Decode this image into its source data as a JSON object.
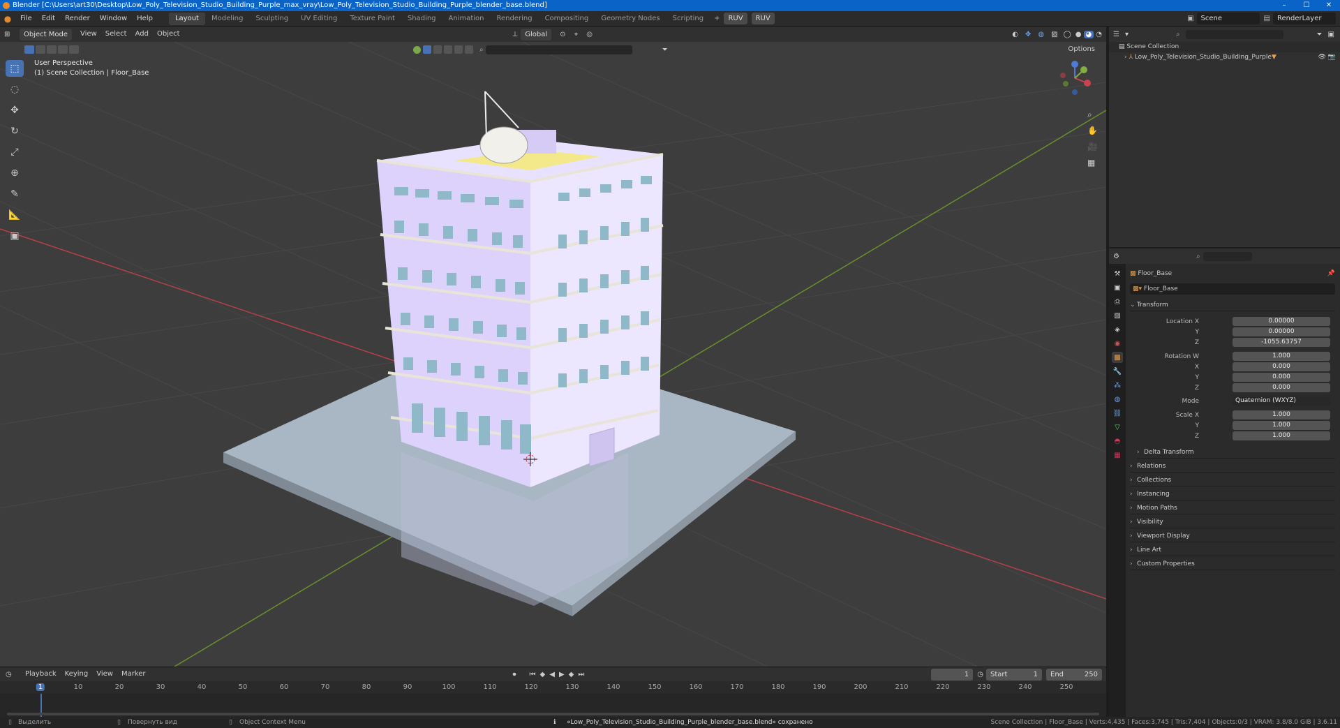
{
  "titlebar": {
    "title": "Blender [C:\\Users\\art30\\Desktop\\Low_Poly_Television_Studio_Building_Purple_max_vray\\Low_Poly_Television_Studio_Building_Purple_blender_base.blend]",
    "minimize": "–",
    "maximize": "☐",
    "close": "✕"
  },
  "menus": [
    "File",
    "Edit",
    "Render",
    "Window",
    "Help"
  ],
  "workspaces": [
    "Layout",
    "Modeling",
    "Sculpting",
    "UV Editing",
    "Texture Paint",
    "Shading",
    "Animation",
    "Rendering",
    "Compositing",
    "Geometry Nodes",
    "Scripting"
  ],
  "ruv_buttons": [
    "RUV",
    "RUV"
  ],
  "scene": {
    "name": "Scene",
    "render_layer": "RenderLayer"
  },
  "viewport": {
    "mode": "Object Mode",
    "menus": [
      "View",
      "Select",
      "Add",
      "Object"
    ],
    "orientation": "Global",
    "options_label": "Options",
    "info_line1": "User Perspective",
    "info_line2": "(1) Scene Collection | Floor_Base"
  },
  "outliner": {
    "root": "Scene Collection",
    "item": "Low_Poly_Television_Studio_Building_Purple"
  },
  "properties": {
    "object_name": "Floor_Base",
    "data_name": "Floor_Base",
    "transform_label": "Transform",
    "location": {
      "label_x": "Location X",
      "label_y": "Y",
      "label_z": "Z",
      "x": "0.00000",
      "y": "0.00000",
      "z": "-1055.63757"
    },
    "rotation": {
      "label_w": "Rotation W",
      "label_x": "X",
      "label_y": "Y",
      "label_z": "Z",
      "w": "1.000",
      "x": "0.000",
      "y": "0.000",
      "z": "0.000"
    },
    "mode_label": "Mode",
    "mode_value": "Quaternion (WXYZ)",
    "scale": {
      "label_x": "Scale X",
      "label_y": "Y",
      "label_z": "Z",
      "x": "1.000",
      "y": "1.000",
      "z": "1.000"
    },
    "delta_transform": "Delta Transform",
    "panels": [
      "Relations",
      "Collections",
      "Instancing",
      "Motion Paths",
      "Visibility",
      "Viewport Display",
      "Line Art",
      "Custom Properties"
    ]
  },
  "timeline": {
    "menus": [
      "Playback",
      "Keying",
      "View",
      "Marker"
    ],
    "current_frame": "1",
    "start_label": "Start",
    "start": "1",
    "end_label": "End",
    "end": "250",
    "ticks": [
      "1",
      "10",
      "20",
      "30",
      "40",
      "50",
      "60",
      "70",
      "80",
      "90",
      "100",
      "110",
      "120",
      "130",
      "140",
      "150",
      "160",
      "170",
      "180",
      "190",
      "200",
      "210",
      "220",
      "230",
      "240",
      "250"
    ]
  },
  "statusbar": {
    "select": "Выделить",
    "rotate": "Повернуть вид",
    "context": "Object Context Menu",
    "message": "«Low_Poly_Television_Studio_Building_Purple_blender_base.blend» сохранено",
    "stats": "Scene Collection | Floor_Base | Verts:4,435 | Faces:3,745 | Tris:7,404 | Objects:0/3 | VRAM: 3.8/8.0 GiB | 3.6.11"
  },
  "colors": {
    "accent": "#4772b3",
    "building": "#d8cdf8",
    "floor": "#a9b6c3",
    "axis_x": "#b5414a",
    "axis_y": "#6a8f2c"
  }
}
